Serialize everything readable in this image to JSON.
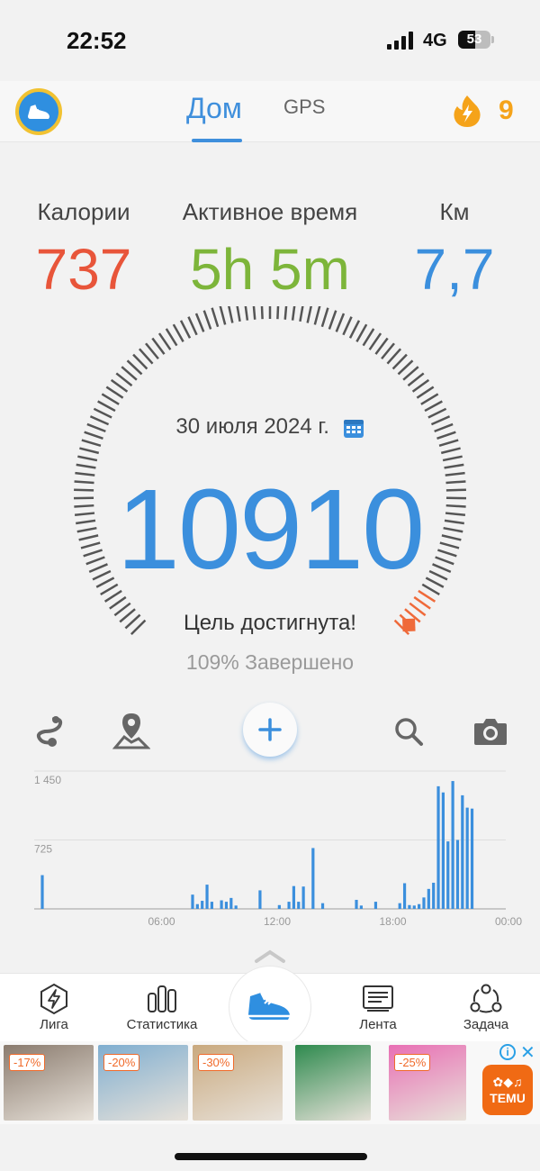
{
  "status_bar": {
    "time": "22:52",
    "network": "4G",
    "battery_level": "53",
    "battery_percent": 53
  },
  "top_nav": {
    "tabs": [
      {
        "label": "Дом",
        "active": true
      },
      {
        "label": "GPS",
        "active": false
      }
    ],
    "streak_count": "9"
  },
  "stats": {
    "calories": {
      "label": "Калории",
      "value": "737",
      "color": "#e8553a"
    },
    "active_time": {
      "label": "Активное время",
      "value": "5h 5m",
      "color": "#7db53a"
    },
    "distance": {
      "label": "Км",
      "value": "7,7",
      "color": "#3b8fdd"
    }
  },
  "progress": {
    "date": "30 июля 2024 г.",
    "steps": "10910",
    "goal_text": "Цель достигнута!",
    "complete_text": "109% Завершено",
    "percent": 109
  },
  "toolbar": {
    "icons": [
      "route-icon",
      "map-pin-icon",
      "add-icon",
      "search-icon",
      "camera-icon"
    ]
  },
  "chart_data": {
    "type": "bar",
    "x_ticks": [
      "06:00",
      "12:00",
      "18:00",
      "00:00"
    ],
    "y_ticks": [
      "1 450",
      "725"
    ],
    "ylim": [
      0,
      1450
    ],
    "x": [
      0.1,
      7.75,
      8.0,
      8.25,
      8.5,
      8.75,
      9.25,
      9.5,
      9.75,
      10.0,
      11.25,
      12.25,
      12.75,
      13.0,
      13.25,
      13.5,
      14.0,
      14.5,
      16.25,
      16.5,
      17.25,
      18.5,
      18.75,
      19.0,
      19.25,
      19.5,
      19.75,
      20.0,
      20.25,
      20.5,
      20.75,
      21.0,
      21.25,
      21.5,
      21.75,
      22.0,
      22.25
    ],
    "values": [
      355,
      150,
      50,
      85,
      255,
      75,
      90,
      75,
      115,
      35,
      195,
      40,
      75,
      240,
      75,
      235,
      640,
      60,
      95,
      35,
      75,
      60,
      270,
      40,
      35,
      50,
      120,
      210,
      275,
      1290,
      1225,
      710,
      1345,
      725,
      1195,
      1065,
      1055
    ],
    "grid": true
  },
  "bottom_nav": {
    "items": [
      {
        "label": "Лига"
      },
      {
        "label": "Статистика"
      },
      {
        "label": "Лента"
      },
      {
        "label": "Задача"
      }
    ]
  },
  "ad": {
    "tiles": [
      {
        "badge": "-17%",
        "bg": "#8a7b6e"
      },
      {
        "badge": "-20%",
        "bg": "#7faed0"
      },
      {
        "badge": "-30%",
        "bg": "#c9a97e"
      },
      {
        "badge": "",
        "bg": "#2e8a4e"
      },
      {
        "badge": "-25%",
        "bg": "#e86fb4"
      }
    ],
    "info": "i",
    "close": "✕",
    "brand_line1": "",
    "brand_line2": "TEMU"
  }
}
